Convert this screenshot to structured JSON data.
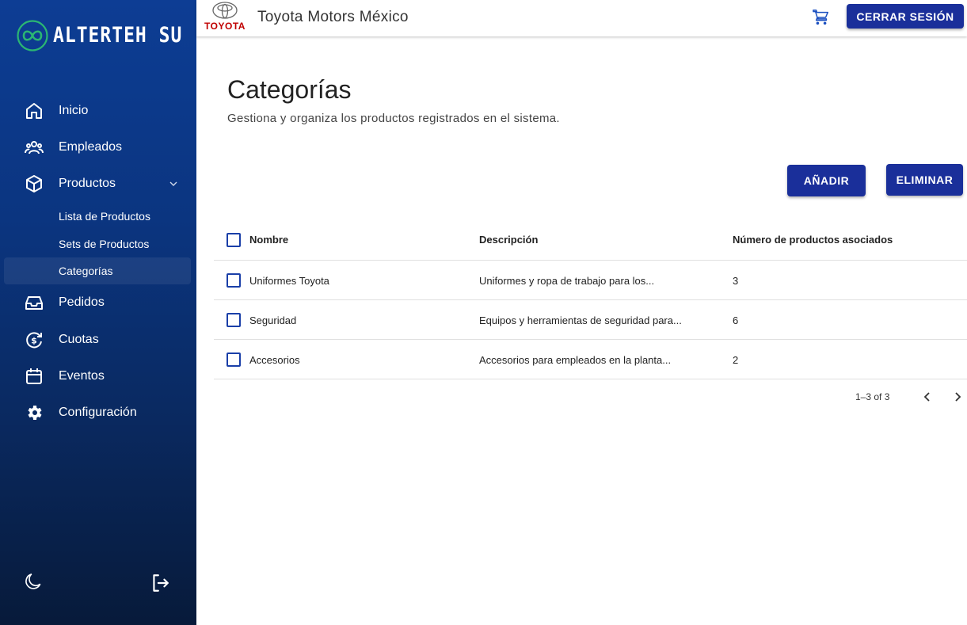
{
  "brand": {
    "name": "ALTERTEH SU"
  },
  "sidebar": {
    "items": [
      {
        "label": "Inicio",
        "icon": "home-icon"
      },
      {
        "label": "Empleados",
        "icon": "users-icon"
      },
      {
        "label": "Productos",
        "icon": "box-icon",
        "expanded": true
      },
      {
        "label": "Pedidos",
        "icon": "inbox-icon"
      },
      {
        "label": "Cuotas",
        "icon": "dollar-cycle-icon"
      },
      {
        "label": "Eventos",
        "icon": "calendar-icon"
      },
      {
        "label": "Configuración",
        "icon": "gear-icon"
      }
    ],
    "subitems": [
      {
        "label": "Lista de Productos"
      },
      {
        "label": "Sets de Productos"
      },
      {
        "label": "Categorías",
        "active": true
      }
    ],
    "bottom": {
      "theme_icon": "moon-icon",
      "logout_icon": "logout-icon"
    }
  },
  "topbar": {
    "logo_text": "TOYOTA",
    "company": "Toyota Motors México",
    "cart_icon": "cart-icon",
    "logout_label": "CERRAR SESIÓN"
  },
  "page": {
    "title": "Categorías",
    "subtitle": "Gestiona y organiza los productos registrados en el sistema.",
    "add_label": "AÑADIR",
    "delete_label": "ELIMINAR"
  },
  "table": {
    "headers": [
      "Nombre",
      "Descripción",
      "Número de productos asociados"
    ],
    "rows": [
      {
        "name": "Uniformes Toyota",
        "desc": "Uniformes y ropa de trabajo para los...",
        "count": "3"
      },
      {
        "name": "Seguridad",
        "desc": "Equipos y herramientas de seguridad para...",
        "count": "6"
      },
      {
        "name": "Accesorios",
        "desc": "Accesorios para empleados en la planta...",
        "count": "2"
      }
    ],
    "pagination": "1–3 of 3"
  },
  "colors": {
    "primary": "#1a2f9a",
    "sidebar_top": "#0d3d94",
    "sidebar_bottom": "#071a3a",
    "brand_accent": "#2bb673",
    "toyota_red": "#c00000"
  }
}
